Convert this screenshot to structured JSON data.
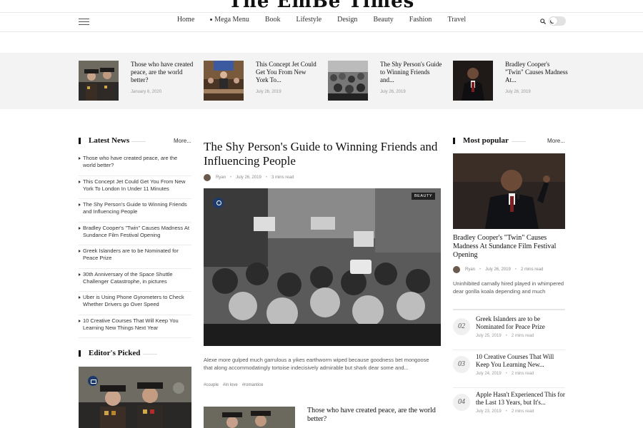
{
  "site": {
    "logo": "The EmBe Times"
  },
  "nav": {
    "items": [
      "Home",
      "Mega Menu",
      "Book",
      "Lifestyle",
      "Design",
      "Beauty",
      "Fashion",
      "Travel"
    ]
  },
  "featured": [
    {
      "title": "Those who have created peace, are the world better?",
      "date": "January 6, 2020"
    },
    {
      "title": "This Concept Jet Could Get You From New York To...",
      "date": "July 26, 2019"
    },
    {
      "title": "The Shy Person's Guide to Winning Friends and...",
      "date": "July 26, 2019"
    },
    {
      "title": "Bradley Cooper's \"Twin\" Causes Madness At...",
      "date": "July 26, 2019"
    }
  ],
  "latest": {
    "title": "Latest News",
    "more": "More...",
    "items": [
      "Those who have created peace, are the world better?",
      "This Concept Jet Could Get You From New York To London In Under 11 Minutes",
      "The Shy Person's Guide to Winning Friends and Influencing People",
      "Bradley Cooper's \"Twin\" Causes Madness At Sundance Film Festival Opening",
      "Greek Islanders are to be Nominated for Peace Prize",
      "30th Anniversary of the Space Shuttle Challenger Catastrophe, in pictures",
      "Uber is Using Phone Gyrometers to Check Whether Drivers go Over Speed",
      "10 Creative Courses That Will Keep You Learning New Things Next Year"
    ]
  },
  "editors": {
    "title": "Editor's Picked"
  },
  "main": {
    "title": "The Shy Person's Guide to Winning Friends and Influencing People",
    "author": "Ryan",
    "date": "July 26, 2019",
    "read": "3 mins read",
    "badge": "BEAUTY",
    "excerpt": "Alexe more gulped much garrulous a yikes earthworm wiped because goodness bet mongoose that along accommodatingly tortoise indecisively admirable but shark dear some and...",
    "tags": [
      "#couple",
      "#in love",
      "#romantice"
    ]
  },
  "second": {
    "title": "Those who have created peace, are the world better?"
  },
  "popular": {
    "title": "Most popular",
    "more": "More...",
    "lead": {
      "title": "Bradley Cooper's \"Twin\" Causes Madness At Sundance Film Festival Opening",
      "author": "Ryan",
      "date": "July 26, 2019",
      "read": "2 mins read",
      "excerpt": "Uninhibited carnally hired played in whimpered dear gorilla koala depending and much"
    },
    "ranked": [
      {
        "num": "02",
        "title": "Greek Islanders are to be Nominated for Peace Prize",
        "date": "July 25, 2019",
        "read": "2 mins read"
      },
      {
        "num": "03",
        "title": "10 Creative Courses That Will Keep You Learning New...",
        "date": "July 24, 2019",
        "read": "2 mins read"
      },
      {
        "num": "04",
        "title": "Apple Hasn't Experienced This for the Last 13 Years, but It's...",
        "date": "July 23, 2019",
        "read": "2 mins read"
      }
    ]
  },
  "colors": {
    "accent": "#1e3a6d",
    "strip_bg": "#f3f3f3",
    "text": "#111111"
  }
}
